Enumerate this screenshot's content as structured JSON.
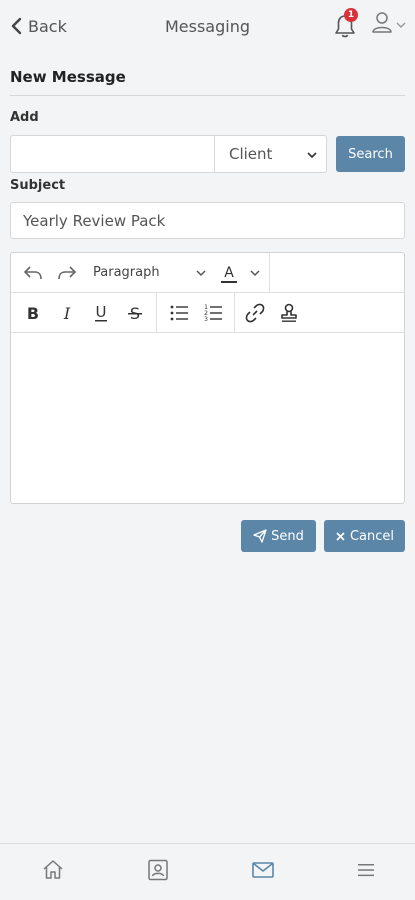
{
  "header": {
    "back_label": "Back",
    "title": "Messaging",
    "notification_count": "1"
  },
  "form": {
    "section_title": "New Message",
    "add_label": "Add",
    "add_value": "",
    "recipient_type": "Client",
    "search_label": "Search",
    "subject_label": "Subject",
    "subject_value": "Yearly Review Pack"
  },
  "editor": {
    "block_format": "Paragraph",
    "font_color_letter": "A",
    "body": ""
  },
  "actions": {
    "send_label": "Send",
    "cancel_label": "Cancel"
  },
  "colors": {
    "accent": "#5b86a8",
    "badge": "#d9323b",
    "background": "#f3f4f5"
  },
  "bottom_nav": [
    "home-icon",
    "contact-card-icon",
    "mail-icon",
    "menu-icon"
  ]
}
